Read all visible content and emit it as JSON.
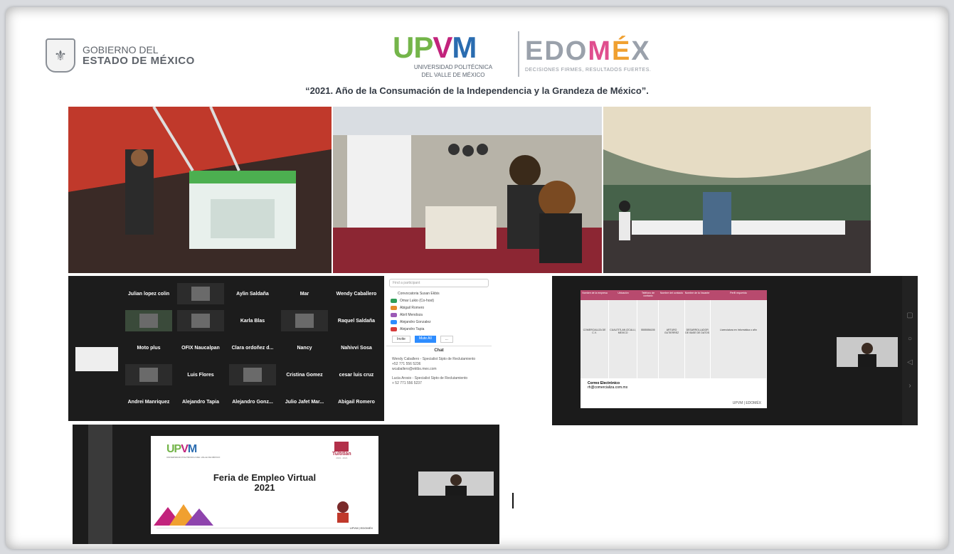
{
  "header": {
    "gov_line1": "GOBIERNO DEL",
    "gov_line2": "ESTADO DE MÉXICO",
    "upvm_logo": "UPVM",
    "upvm_sub1": "UNIVERSIDAD POLITÉCNICA",
    "upvm_sub2": "DEL VALLE DE MÉXICO",
    "edomex_logo": "EDOMÉX",
    "edomex_tagline": "DECISIONES FIRMES, RESULTADOS FUERTES.",
    "motto": "“2021. Año de la Consumación de la Independencia y la Grandeza de México”."
  },
  "zoom_meeting": {
    "participants": [
      "Julian lopez colin",
      "",
      "Aylin Saldaña",
      "Mar",
      "Wendy Caballero",
      "",
      "",
      "Karla Blas",
      "",
      "Raquel Saldaña",
      "Moto plus",
      "OFIX Naucalpan",
      "Clara ordoñez d...",
      "Nancy",
      "Nahivvi Sosa",
      "",
      "Luis Flores",
      "",
      "Cristina Gomez",
      "cesar luis cruz",
      "Andrei Manriquez",
      "Alejandro Tapia",
      "Alejandro Gonz...",
      "Julio Jafet Mar...",
      "Abigail Romero"
    ],
    "panel": {
      "search_placeholder": "Find a participant",
      "host_label": "Convocatoria Susan Ekbis",
      "people": [
        "Omar Lukio (Co-host)",
        "Abigail Romero",
        "Abril Mendoza",
        "Alejandro Gonzalez",
        "Alejandro Tapia"
      ],
      "invite_label": "Invite",
      "mute_all_label": "Mute All",
      "more_label": "...",
      "chat_title": "Chat",
      "chat_messages": [
        "Wendy Caballero - Specialist Sipto de Reclutamiento",
        "+52 771 556 5236",
        "wcaballero@ektbs.mex.com",
        "Lucia Arosio - Specialist Sipto de Reclutamiento",
        "+ 52 771 556 5237"
      ]
    }
  },
  "job_table_share": {
    "columns": [
      "Nombre de la empresa",
      "Ubicación",
      "Teléfono de contacto",
      "Nombre del contacto",
      "Nombre de la Vacante",
      "Perfil requerido"
    ],
    "row": [
      "COMERCIALIZA DE C.V.",
      "CUAUTITLAN IZCALLI, MEXICO",
      "5555556155",
      "ARTURO GUTIERREZ",
      "DESARROLLADOR DE BASE DE DATOS",
      "Licenciatura en Informática o afín"
    ],
    "email_label": "Correo Electrónico",
    "email_value": "rh@comercializa.com.mx",
    "footer_right": "UPVM | EDOMÉX"
  },
  "virtual_fair_slide": {
    "upvm_logo": "UPVM",
    "upvm_sub": "UNIVERSIDAD POLITÉCNICA DEL VALLE DE MÉXICO",
    "tultitlan_logo": "Tultitlán",
    "tultitlan_sub": "2019 - 2021",
    "title_line1": "Feria de Empleo Virtual",
    "title_line2": "2021",
    "footer_right": "UPVM | EDOMÉX"
  },
  "colors": {
    "upvm_green": "#74b54a",
    "upvm_magenta": "#c2237c",
    "upvm_blue": "#2a6cb0",
    "zoom_bg": "#1c1c1c",
    "table_header": "#b84a6e"
  }
}
